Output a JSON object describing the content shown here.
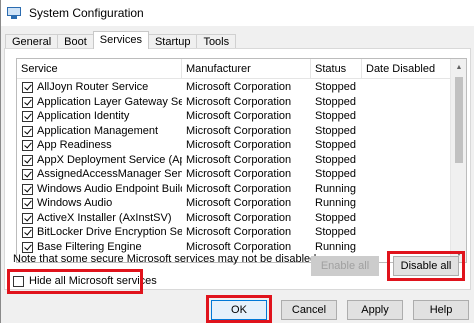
{
  "window": {
    "title": "System Configuration"
  },
  "tabs": [
    {
      "label": "General"
    },
    {
      "label": "Boot"
    },
    {
      "label": "Services"
    },
    {
      "label": "Startup"
    },
    {
      "label": "Tools"
    }
  ],
  "active_tab": "Services",
  "columns": [
    "Service",
    "Manufacturer",
    "Status",
    "Date Disabled"
  ],
  "services": [
    {
      "name": "AllJoyn Router Service",
      "manufacturer": "Microsoft Corporation",
      "status": "Stopped",
      "date_disabled": "",
      "checked": true
    },
    {
      "name": "Application Layer Gateway Service",
      "manufacturer": "Microsoft Corporation",
      "status": "Stopped",
      "date_disabled": "",
      "checked": true
    },
    {
      "name": "Application Identity",
      "manufacturer": "Microsoft Corporation",
      "status": "Stopped",
      "date_disabled": "",
      "checked": true
    },
    {
      "name": "Application Management",
      "manufacturer": "Microsoft Corporation",
      "status": "Stopped",
      "date_disabled": "",
      "checked": true
    },
    {
      "name": "App Readiness",
      "manufacturer": "Microsoft Corporation",
      "status": "Stopped",
      "date_disabled": "",
      "checked": true
    },
    {
      "name": "AppX Deployment Service (AppX...",
      "manufacturer": "Microsoft Corporation",
      "status": "Stopped",
      "date_disabled": "",
      "checked": true
    },
    {
      "name": "AssignedAccessManager Service",
      "manufacturer": "Microsoft Corporation",
      "status": "Stopped",
      "date_disabled": "",
      "checked": true
    },
    {
      "name": "Windows Audio Endpoint Builder",
      "manufacturer": "Microsoft Corporation",
      "status": "Running",
      "date_disabled": "",
      "checked": true
    },
    {
      "name": "Windows Audio",
      "manufacturer": "Microsoft Corporation",
      "status": "Running",
      "date_disabled": "",
      "checked": true
    },
    {
      "name": "ActiveX Installer (AxInstSV)",
      "manufacturer": "Microsoft Corporation",
      "status": "Stopped",
      "date_disabled": "",
      "checked": true
    },
    {
      "name": "BitLocker Drive Encryption Service",
      "manufacturer": "Microsoft Corporation",
      "status": "Stopped",
      "date_disabled": "",
      "checked": true
    },
    {
      "name": "Base Filtering Engine",
      "manufacturer": "Microsoft Corporation",
      "status": "Running",
      "date_disabled": "",
      "checked": true
    }
  ],
  "note": "Note that some secure Microsoft services may not be disabled.",
  "buttons": {
    "enable_all": "Enable all",
    "disable_all": "Disable all",
    "ok": "OK",
    "cancel": "Cancel",
    "apply": "Apply",
    "help": "Help"
  },
  "hide_option": {
    "label": "Hide all Microsoft services",
    "checked": false
  },
  "highlight_color": "#e0131c"
}
